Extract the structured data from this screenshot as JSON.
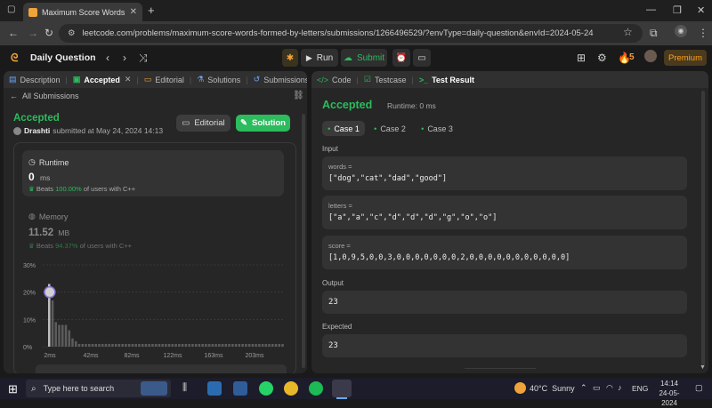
{
  "browser": {
    "tab_title": "Maximum Score Words Formed",
    "url": "leetcode.com/problems/maximum-score-words-formed-by-letters/submissions/1266496529/?envType=daily-question&envId=2024-05-24"
  },
  "topbar": {
    "daily_question": "Daily Question",
    "run": "Run",
    "submit": "Submit",
    "streak": "5",
    "premium": "Premium"
  },
  "left": {
    "tabs": [
      "Description",
      "Accepted",
      "Editorial",
      "Solutions",
      "Submissions"
    ],
    "back_label": "All Submissions",
    "status": "Accepted",
    "user": "Drashti",
    "submitted_text": "submitted at May 24, 2024 14:13",
    "editorial_btn": "Editorial",
    "solution_btn": "Solution",
    "runtime": {
      "label": "Runtime",
      "value": "0",
      "unit": "ms",
      "beats_prefix": "Beats",
      "beats_pct": "100.00%",
      "beats_suffix": "of users with C++"
    },
    "memory": {
      "label": "Memory",
      "value": "11.52",
      "unit": "MB",
      "beats_prefix": "Beats",
      "beats_pct": "94.37%",
      "beats_suffix": "of users with C++"
    }
  },
  "chart_data": {
    "type": "bar",
    "y_ticks": [
      "30%",
      "20%",
      "10%",
      "0%"
    ],
    "ylim": [
      0,
      30
    ],
    "x_ticks": [
      "2ms",
      "42ms",
      "82ms",
      "122ms",
      "163ms",
      "203ms"
    ],
    "values": [
      23,
      17,
      9,
      8,
      8,
      8,
      6,
      3,
      2,
      1,
      1,
      1,
      1,
      1,
      1,
      1,
      1,
      1,
      1,
      1,
      1,
      1,
      1,
      1,
      1,
      1,
      1,
      1,
      1,
      1,
      1,
      1,
      1,
      1,
      1,
      1,
      1,
      1,
      1,
      1,
      1,
      1,
      1,
      1,
      1,
      1,
      1,
      1,
      1,
      1,
      1,
      1,
      1,
      1,
      1,
      1,
      1,
      1,
      1,
      1,
      1,
      1,
      1,
      1,
      1,
      1,
      1,
      1,
      1,
      1,
      1
    ],
    "highlight_index": 0,
    "highlight_value": 20
  },
  "right": {
    "tabs": [
      "Code",
      "Testcase",
      "Test Result"
    ],
    "status": "Accepted",
    "runtime": "Runtime: 0 ms",
    "cases": [
      "Case 1",
      "Case 2",
      "Case 3"
    ],
    "input_label": "Input",
    "words_label": "words =",
    "words_value": "[\"dog\",\"cat\",\"dad\",\"good\"]",
    "letters_label": "letters =",
    "letters_value": "[\"a\",\"a\",\"c\",\"d\",\"d\",\"d\",\"g\",\"o\",\"o\"]",
    "score_label": "score =",
    "score_value": "[1,0,9,5,0,0,3,0,0,0,0,0,0,0,2,0,0,0,0,0,0,0,0,0,0,0]",
    "output_label": "Output",
    "output_value": "23",
    "expected_label": "Expected",
    "expected_value": "23"
  },
  "taskbar": {
    "search_placeholder": "Type here to search",
    "weather": "40°C  Sunny",
    "lang": "ENG",
    "time": "14:14",
    "date": "24-05-2024"
  },
  "colors": {
    "accent_green": "#2cbb5d",
    "premium_orange": "#ffa116"
  }
}
